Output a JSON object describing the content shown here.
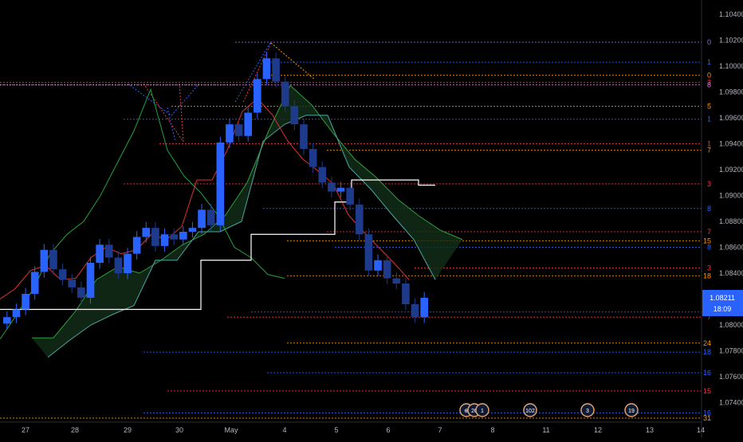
{
  "chart_data": {
    "type": "candlestick",
    "ylim": [
      1.0726,
      1.1044
    ],
    "y_ticks": [
      "1.10400",
      "1.10200",
      "1.10000",
      "1.09800",
      "1.09600",
      "1.09400",
      "1.09200",
      "1.09000",
      "1.08800",
      "1.08600",
      "1.08400",
      "1.08000",
      "1.07800",
      "1.07600",
      "1.07400"
    ],
    "x_ticks": [
      "27",
      "28",
      "29",
      "30",
      "May",
      "4",
      "5",
      "6",
      "7",
      "8",
      "11",
      "12",
      "13",
      "14"
    ],
    "price_badge": {
      "price": "1.08211",
      "countdown": "18:09"
    },
    "candles_close": [
      1.0806,
      1.0812,
      1.0824,
      1.0841,
      1.0858,
      1.0843,
      1.0835,
      1.0829,
      1.0821,
      1.0848,
      1.0862,
      1.0852,
      1.084,
      1.0855,
      1.0868,
      1.0875,
      1.0861,
      1.087,
      1.0866,
      1.0872,
      1.0875,
      1.0889,
      1.0877,
      1.0941,
      1.0955,
      1.0946,
      1.0964,
      1.099,
      1.1006,
      1.0988,
      1.0969,
      1.0955,
      1.0936,
      1.0922,
      1.091,
      1.0903,
      1.0906,
      1.0893,
      1.087,
      1.0842,
      1.085,
      1.0836,
      1.0832,
      1.0816,
      1.0806,
      1.0821
    ],
    "tenkan": [
      1.082,
      1.0828,
      1.0842,
      1.0846,
      1.0835,
      1.0836,
      1.0852,
      1.086,
      1.0855,
      1.0858,
      1.087,
      1.0866,
      1.0876,
      1.0912,
      1.0912,
      1.0935,
      1.0965,
      1.0975,
      1.0962,
      1.0942,
      1.0928,
      1.0919,
      1.0909,
      1.0885,
      1.0872,
      1.086,
      1.0848,
      1.0835
    ],
    "kijun": [
      1.0812,
      1.0812,
      1.0812,
      1.0812,
      1.0812,
      1.0812,
      1.0812,
      1.0812,
      1.0812,
      1.0812,
      1.0812,
      1.0812,
      1.085,
      1.085,
      1.085,
      1.087,
      1.087,
      1.087,
      1.087,
      1.087,
      1.0895,
      1.0912,
      1.0912,
      1.0912,
      1.0912,
      1.0908
    ],
    "senkou_a": [
      1.079,
      1.079,
      1.081,
      1.0835,
      1.0845,
      1.084,
      1.085,
      1.0862,
      1.087,
      1.0885,
      1.091,
      1.095,
      1.0985,
      1.097,
      1.0948,
      1.0928,
      1.0914,
      1.0897,
      1.0884,
      1.0873,
      1.0866
    ],
    "senkou_b": [
      1.0775,
      1.0788,
      1.08,
      1.0808,
      1.0815,
      1.085,
      1.085,
      1.0872,
      1.0872,
      1.088,
      1.0942,
      1.0955,
      1.0962,
      1.0962,
      1.0922,
      1.0905,
      1.0885,
      1.0866,
      1.0835
    ],
    "chikou": [
      1.0789,
      1.0808,
      1.0828,
      1.0855,
      1.087,
      1.088,
      1.09,
      1.0925,
      1.095,
      1.0982,
      1.0935,
      1.0915,
      1.0902,
      1.0885,
      1.086,
      1.0852,
      1.0839,
      1.0836
    ],
    "fib_levels": [
      {
        "price": 1.10185,
        "label": "0",
        "color": "#8b6fd6",
        "x_start": 295
      },
      {
        "price": 1.1003,
        "label": "1",
        "color": "#2962ff",
        "x_start": 340
      },
      {
        "price": 1.0993,
        "label": "0",
        "color": "#ff9800",
        "x_start": 340
      },
      {
        "price": 1.09875,
        "label": "3",
        "color": "#f23645",
        "x_start": 0
      },
      {
        "price": 1.09855,
        "label": "8",
        "color": "#e57bd6",
        "x_start": 0
      },
      {
        "price": 1.0969,
        "label": "5",
        "color": "#ff9800",
        "x_start": 215
      },
      {
        "price": 1.0959,
        "label": "1",
        "color": "#2962ff",
        "x_start": 155
      },
      {
        "price": 1.094,
        "label": "1",
        "color": "#f23645",
        "x_start": 200
      },
      {
        "price": 1.0935,
        "label": "7",
        "color": "#ff9800",
        "x_start": 410
      },
      {
        "price": 1.0909,
        "label": "3",
        "color": "#f23645",
        "x_start": 155
      },
      {
        "price": 1.089,
        "label": "8",
        "color": "#2962ff",
        "x_start": 330
      },
      {
        "price": 1.0872,
        "label": "7",
        "color": "#f23645",
        "x_start": 410
      },
      {
        "price": 1.0865,
        "label": "15",
        "color": "#ff9800",
        "x_start": 360
      },
      {
        "price": 1.086,
        "label": "8",
        "color": "#2962ff",
        "x_start": 420
      },
      {
        "price": 1.0844,
        "label": "3",
        "color": "#f23645",
        "x_start": 520
      },
      {
        "price": 1.0838,
        "label": "18",
        "color": "#ff9800",
        "x_start": 360
      },
      {
        "price": 1.081,
        "label": "18",
        "color": "#2962ff",
        "x_start": 315
      },
      {
        "price": 1.0806,
        "label": "7",
        "color": "#f23645",
        "x_start": 285
      },
      {
        "price": 1.0786,
        "label": "24",
        "color": "#ff9800",
        "x_start": 360
      },
      {
        "price": 1.0779,
        "label": "18",
        "color": "#2962ff",
        "x_start": 180
      },
      {
        "price": 1.0763,
        "label": "16",
        "color": "#2962ff",
        "x_start": 335
      },
      {
        "price": 1.0749,
        "label": "15",
        "color": "#f23645",
        "x_start": 210
      },
      {
        "price": 1.0732,
        "label": "16",
        "color": "#2962ff",
        "x_start": 180
      },
      {
        "price": 1.0728,
        "label": "31",
        "color": "#ff9800",
        "x_start": 0
      }
    ],
    "event_flags": [
      {
        "x_label": "7",
        "badges": [
          "⊕",
          "20",
          "1"
        ]
      },
      {
        "x_label": "8",
        "badges": [
          "102"
        ]
      },
      {
        "x_label": "11",
        "badges": [
          "3"
        ]
      },
      {
        "x_label": "12",
        "badges": [
          "19"
        ]
      }
    ],
    "colors": {
      "bull": "#2962ff",
      "bear": "#1e3a8a",
      "tenkan": "#e03030",
      "kijun": "#ffffff",
      "senkou_a": "#2e9e3e",
      "senkou_b": "#4aa6a6",
      "cloud": "#123018",
      "chikou": "#1fa33a",
      "axis": "#b2b5be",
      "badge": "#2962ff"
    }
  }
}
